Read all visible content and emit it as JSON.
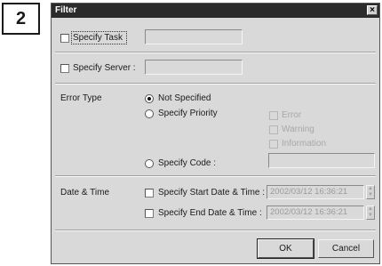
{
  "step_badge": "2",
  "dialog": {
    "title": "Filter",
    "close_glyph": "×"
  },
  "task": {
    "label": "Specify Task",
    "checked": false,
    "value": ""
  },
  "server": {
    "label": "Specify Server :",
    "checked": false,
    "value": ""
  },
  "error_type": {
    "heading": "Error Type",
    "options": [
      "Not Specified",
      "Specify Priority",
      "Specify Code :"
    ],
    "selected": "Not Specified",
    "priorities": [
      "Error",
      "Warning",
      "Information"
    ],
    "code_value": ""
  },
  "date_time": {
    "heading": "Date & Time",
    "start_label": "Specify Start Date & Time :",
    "start_value": "2002/03/12 16:36:21",
    "end_label": "Specify End Date & Time :",
    "end_value": "2002/03/12 16:36:21"
  },
  "buttons": {
    "ok": "OK",
    "cancel": "Cancel"
  },
  "icons": {
    "spinner_up": "▲",
    "spinner_down": "▼"
  }
}
